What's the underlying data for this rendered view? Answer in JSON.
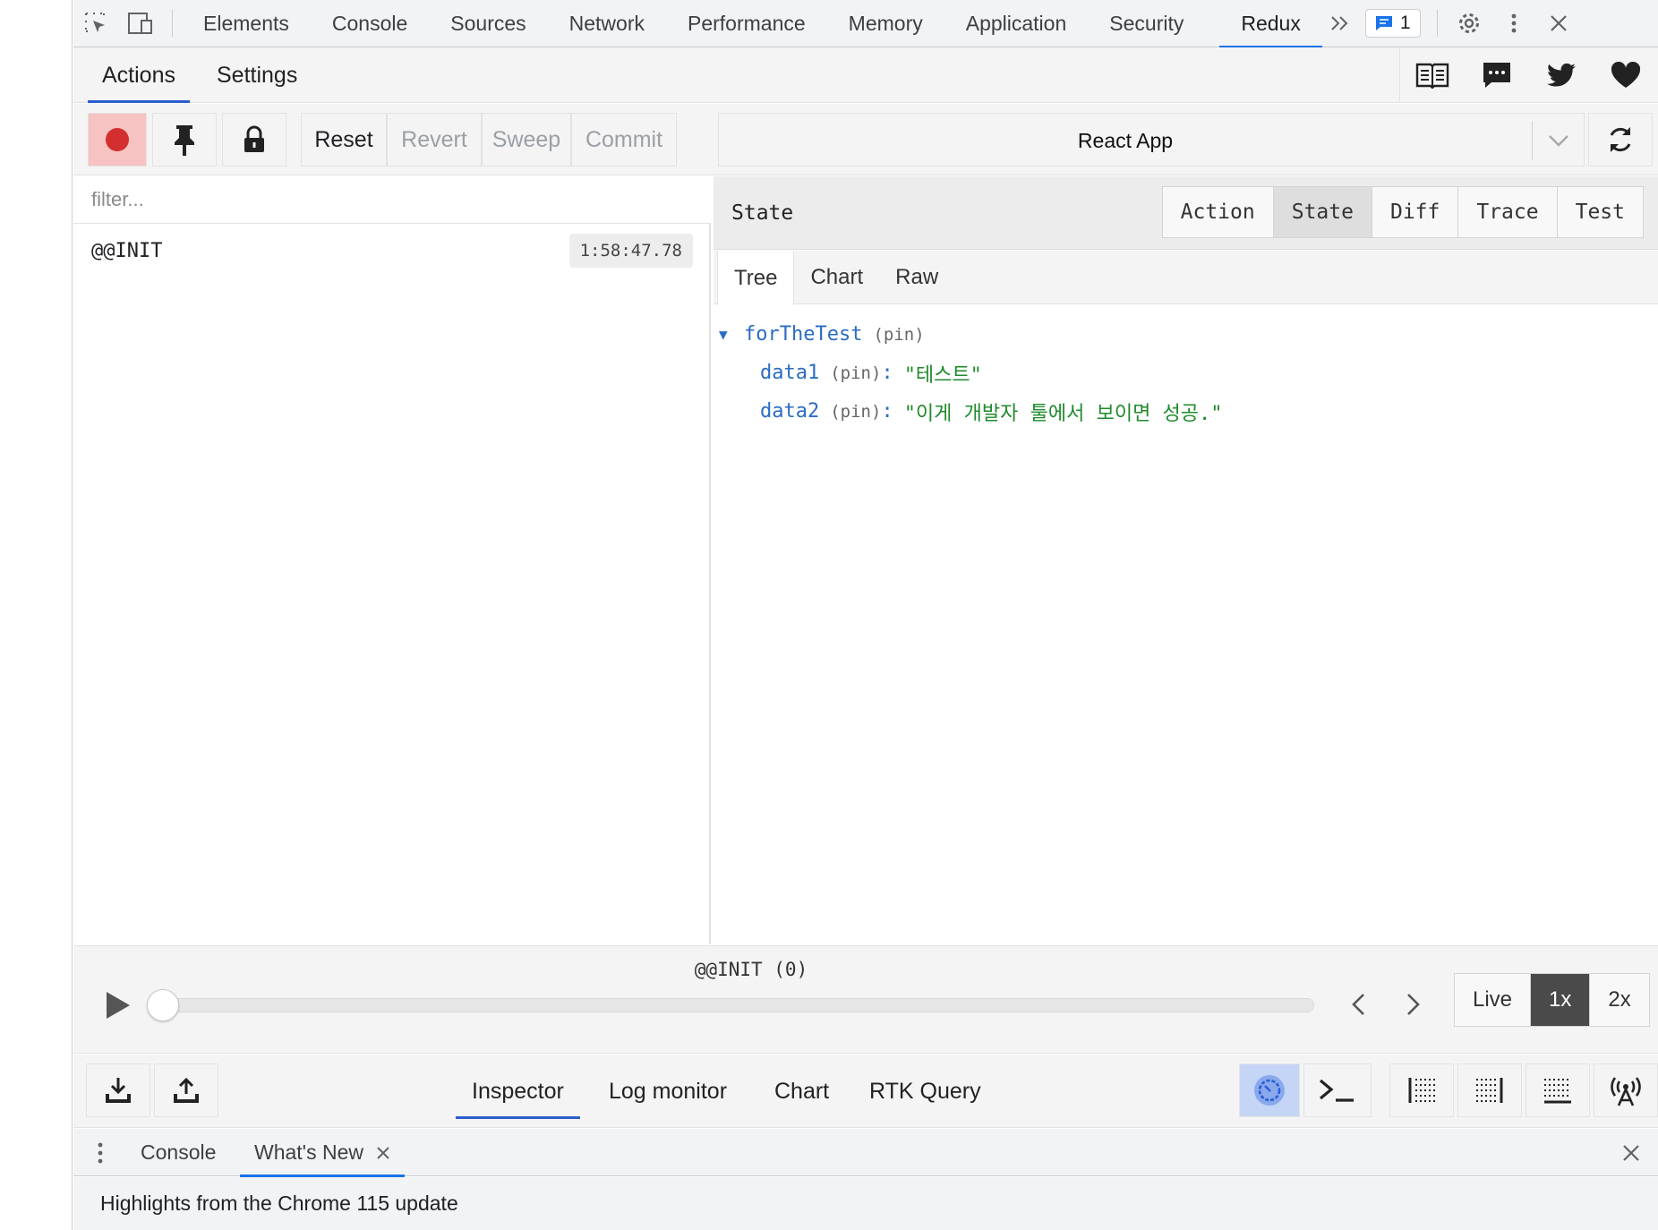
{
  "devtools": {
    "tabs": [
      "Elements",
      "Console",
      "Sources",
      "Network",
      "Performance",
      "Memory",
      "Application",
      "Security",
      "Redux"
    ],
    "active_tab": "Redux",
    "issues_count": "1",
    "accent_color": "#1a73e8"
  },
  "redux": {
    "header_tabs": [
      "Actions",
      "Settings"
    ],
    "active_header_tab": "Actions",
    "header_icons": [
      "docs-icon",
      "chat-icon",
      "twitter-icon",
      "heart-icon"
    ],
    "toolbar": {
      "reset": "Reset",
      "revert": "Revert",
      "sweep": "Sweep",
      "commit": "Commit",
      "instance": "React App",
      "record_color": "#d32f2f"
    },
    "filter_placeholder": "filter...",
    "actions": [
      {
        "name": "@@INIT",
        "time": "1:58:47.78"
      }
    ],
    "state_panel": {
      "title": "State",
      "monitor_tabs": [
        "Action",
        "State",
        "Diff",
        "Trace",
        "Test"
      ],
      "active_monitor_tab": "State",
      "sub_tabs": [
        "Tree",
        "Chart",
        "Raw"
      ],
      "active_sub_tab": "Tree",
      "tree": {
        "root_key": "forTheTest",
        "root_pin": "(pin)",
        "children": [
          {
            "key": "data1",
            "pin": "(pin)",
            "colon": ":",
            "value": "\"테스트\""
          },
          {
            "key": "data2",
            "pin": "(pin)",
            "colon": ":",
            "value": "\"이게 개발자 툴에서 보이면 성공.\""
          }
        ]
      }
    },
    "slider": {
      "label": "@@INIT (0)",
      "position": 0,
      "speeds": [
        "Live",
        "1x",
        "2x"
      ],
      "active_speed": "1x"
    },
    "bottom": {
      "monitor_tabs": [
        "Inspector",
        "Log monitor",
        "Chart",
        "RTK Query"
      ],
      "active_monitor_tab": "Inspector"
    }
  },
  "drawer": {
    "tabs": [
      "Console",
      "What's New"
    ],
    "active_tab": "What's New",
    "content": "Highlights from the Chrome 115 update"
  }
}
